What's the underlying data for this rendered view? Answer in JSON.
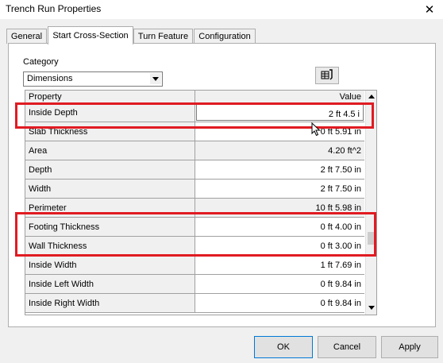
{
  "window": {
    "title": "Trench Run Properties",
    "close_glyph": "✕"
  },
  "tabs": [
    "General",
    "Start Cross-Section",
    "Turn Feature",
    "Configuration"
  ],
  "active_tab": 1,
  "category": {
    "label": "Category",
    "value": "Dimensions"
  },
  "grid": {
    "headers": {
      "property": "Property",
      "value": "Value"
    },
    "rows": [
      {
        "property": "Inside Depth",
        "value": "2 ft 4.5 i",
        "editing": true
      },
      {
        "property": "Slab Thickness",
        "value": "0 ft  5.91 in"
      },
      {
        "property": "Area",
        "value": "4.20 ft^2",
        "readonly": true
      },
      {
        "property": "Depth",
        "value": "2 ft  7.50 in"
      },
      {
        "property": "Width",
        "value": "2 ft  7.50 in"
      },
      {
        "property": "Perimeter",
        "value": "10 ft  5.98 in",
        "readonly": true
      },
      {
        "property": "Footing Thickness",
        "value": "0 ft  4.00 in"
      },
      {
        "property": "Wall Thickness",
        "value": "0 ft  3.00 in"
      },
      {
        "property": "Inside Width",
        "value": "1 ft  7.69 in"
      },
      {
        "property": "Inside Left Width",
        "value": "0 ft  9.84 in"
      },
      {
        "property": "Inside Right Width",
        "value": "0 ft  9.84 in"
      }
    ]
  },
  "buttons": {
    "ok": "OK",
    "cancel": "Cancel",
    "apply": "Apply"
  },
  "icons": {
    "tool_button": "table-edit-icon",
    "dropdown": "chevron-down-icon"
  },
  "colors": {
    "highlight": "#e01b22",
    "window_bg": "#f0f0f0",
    "default_button_border": "#0078d7"
  }
}
